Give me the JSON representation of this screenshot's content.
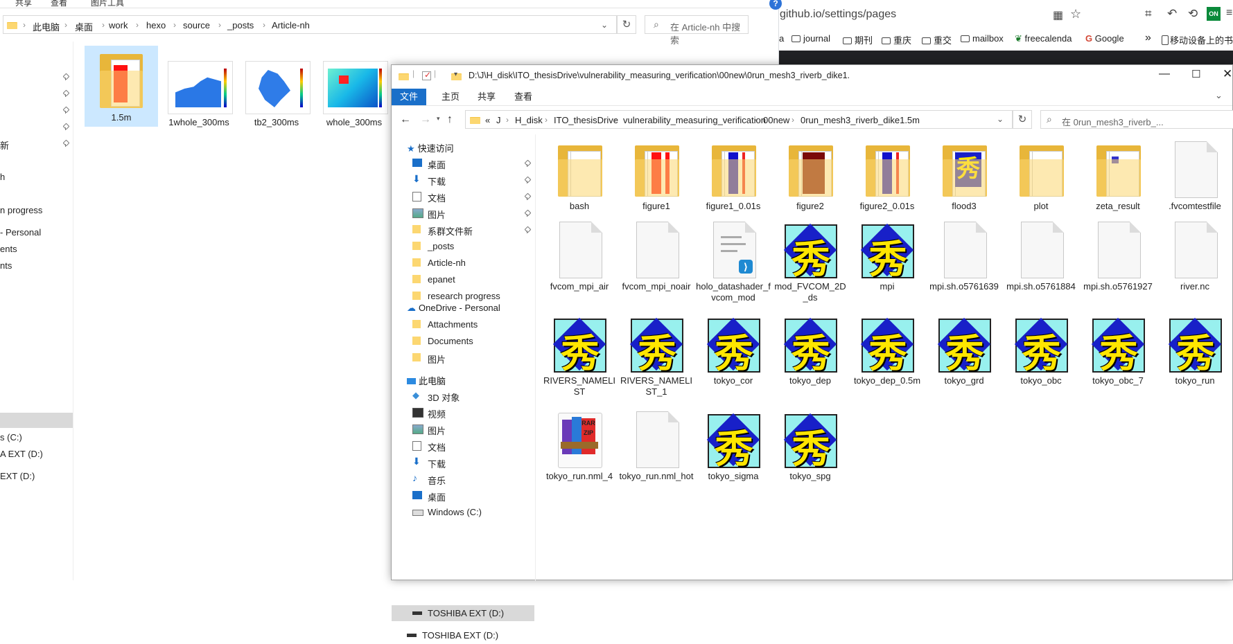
{
  "left_window": {
    "menu_tabs": [
      "共享",
      "查看",
      "图片工具"
    ],
    "breadcrumbs": [
      "此电脑",
      "桌面",
      "work",
      "hexo",
      "source",
      "_posts",
      "Article-nh"
    ],
    "search_placeholder": "在 Article-nh 中搜索",
    "nav_items": [
      "新",
      "h",
      "n progress",
      "- Personal",
      "ents",
      "nts",
      "s (C:)",
      "A EXT (D:)",
      "EXT (D:)"
    ],
    "files": [
      {
        "name": "1.5m",
        "icon": "folder-icon"
      },
      {
        "name": "1whole_300ms",
        "icon": "image-thumb-icon"
      },
      {
        "name": "tb2_300ms",
        "icon": "image-thumb-icon"
      },
      {
        "name": "whole_300ms",
        "icon": "image-thumb-icon"
      }
    ]
  },
  "browser": {
    "url": "github.io/settings/pages",
    "bookmarks": [
      "a",
      "journal",
      "期刊",
      "重庆",
      "重交",
      "mailbox",
      "freecalenda",
      "Google"
    ],
    "overflow_bookmark": "移动设备上的书",
    "help_glyph": "?",
    "ext_badge": "ON"
  },
  "right_window": {
    "title": "D:\\J\\H_disk\\ITO_thesisDrive\\vulnerability_measuring_verification\\00new\\0run_mesh3_riverb_dike1.",
    "ribbon_tabs": [
      "文件",
      "主页",
      "共享",
      "查看"
    ],
    "breadcrumbs": [
      "«",
      "J",
      "H_disk",
      "ITO_thesisDrive",
      "vulnerability_measuring_verification",
      "00new",
      "0run_mesh3_riverb_dike1.5m"
    ],
    "search_placeholder": "在 0run_mesh3_riverb_...",
    "quick_access_label": "快速访问",
    "quick_access": [
      "桌面",
      "下载",
      "文档",
      "图片",
      "系群文件新",
      "_posts",
      "Article-nh",
      "epanet",
      "research progress"
    ],
    "onedrive_label": "OneDrive - Personal",
    "onedrive": [
      "Attachments",
      "Documents",
      "图片"
    ],
    "pc_label": "此电脑",
    "pc": [
      "3D 对象",
      "视频",
      "图片",
      "文档",
      "下载",
      "音乐",
      "桌面",
      "Windows (C:)",
      "TOSHIBA EXT (D:)"
    ],
    "extra_drive": "TOSHIBA EXT (D:)",
    "files": [
      {
        "name": "bash",
        "icon": "folder"
      },
      {
        "name": "figure1",
        "icon": "folder-red"
      },
      {
        "name": "figure1_0.01s",
        "icon": "folder-blue"
      },
      {
        "name": "figure2",
        "icon": "folder-dark"
      },
      {
        "name": "figure2_0.01s",
        "icon": "folder-blue"
      },
      {
        "name": "flood3",
        "icon": "folder-shu"
      },
      {
        "name": "plot",
        "icon": "folder"
      },
      {
        "name": "zeta_result",
        "icon": "folder-doc"
      },
      {
        "name": ".fvcomtestfile",
        "icon": "doc"
      },
      {
        "name": "fvcom_mpi_air",
        "icon": "doc"
      },
      {
        "name": "fvcom_mpi_noair",
        "icon": "doc"
      },
      {
        "name": "holo_datashader_fvcom_mod",
        "icon": "vscode"
      },
      {
        "name": "mod_FVCOM_2D_ds",
        "icon": "shu"
      },
      {
        "name": "mpi",
        "icon": "shu"
      },
      {
        "name": "mpi.sh.o5761639",
        "icon": "doc"
      },
      {
        "name": "mpi.sh.o5761884",
        "icon": "doc"
      },
      {
        "name": "mpi.sh.o5761927",
        "icon": "doc"
      },
      {
        "name": "river.nc",
        "icon": "doc"
      },
      {
        "name": "RIVERS_NAMELIST",
        "icon": "shu"
      },
      {
        "name": "RIVERS_NAMELIST_1",
        "icon": "shu"
      },
      {
        "name": "tokyo_cor",
        "icon": "shu"
      },
      {
        "name": "tokyo_dep",
        "icon": "shu"
      },
      {
        "name": "tokyo_dep_0.5m",
        "icon": "shu"
      },
      {
        "name": "tokyo_grd",
        "icon": "shu"
      },
      {
        "name": "tokyo_obc",
        "icon": "shu"
      },
      {
        "name": "tokyo_obc_7",
        "icon": "shu"
      },
      {
        "name": "tokyo_run",
        "icon": "shu"
      },
      {
        "name": "tokyo_run.nml_4",
        "icon": "winrar"
      },
      {
        "name": "tokyo_run.nml_hot",
        "icon": "doc"
      },
      {
        "name": "tokyo_sigma",
        "icon": "shu"
      },
      {
        "name": "tokyo_spg",
        "icon": "shu"
      }
    ],
    "shu_glyph": "秀",
    "rar_text": [
      "RAR",
      "ZIP"
    ]
  },
  "colors": {
    "accent": "#1a6fc9",
    "selected": "#cce8ff",
    "folder": "#fcd771"
  }
}
